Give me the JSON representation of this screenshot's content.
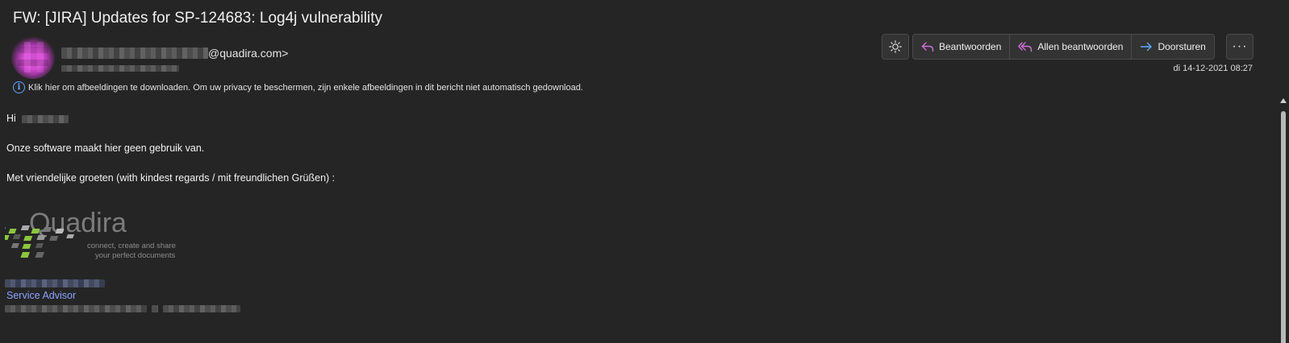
{
  "message": {
    "subject": "FW: [JIRA] Updates for SP-124683: Log4j vulnerability",
    "sender_domain": "@quadira.com>",
    "date": "di 14-12-2021 08:27",
    "info_banner": "Klik hier om afbeeldingen te downloaden. Om uw privacy te beschermen, zijn enkele afbeeldingen in dit bericht niet automatisch gedownload."
  },
  "toolbar": {
    "reply_label": "Beantwoorden",
    "reply_all_label": "Allen beantwoorden",
    "forward_label": "Doorsturen",
    "more_label": "···"
  },
  "body": {
    "greeting": "Hi",
    "line1": "Onze software maakt hier geen gebruik van.",
    "closing": "Met vriendelijke groeten (with kindest regards / mit freundlichen Grüßen) :"
  },
  "signature": {
    "logo_text": "Quadira",
    "logo_tagline_1": "connect, create and share",
    "logo_tagline_2": "your perfect documents",
    "title": "Service Advisor"
  },
  "colors": {
    "background": "#252525",
    "reply_icon": "#d070d8",
    "forward_icon": "#5ea8ff",
    "link": "#8aa4ff",
    "logo_green": "#8cc63f"
  },
  "icons": {
    "theme": "sun-icon",
    "reply": "reply-icon",
    "reply_all": "reply-all-icon",
    "forward": "forward-icon",
    "more": "more-icon",
    "info": "info-icon"
  }
}
